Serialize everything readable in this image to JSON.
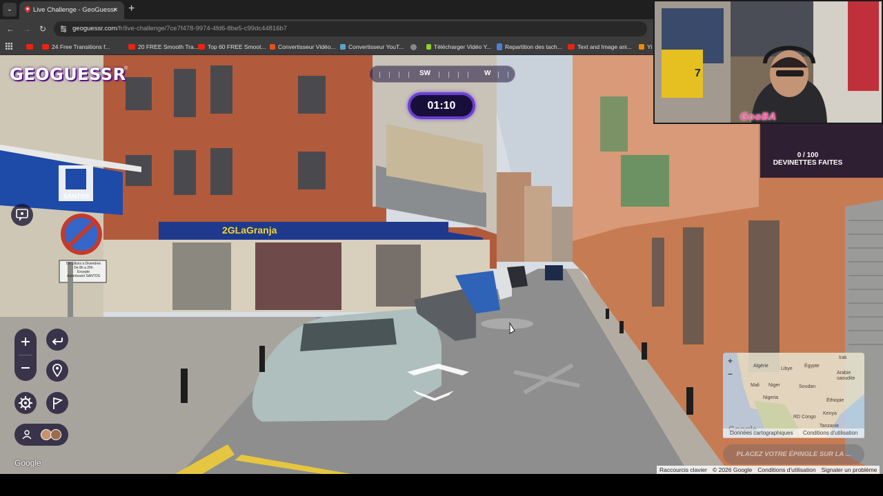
{
  "browser": {
    "tab_title": "Live Challenge - GeoGuessr",
    "url_host": "geoguessr.com",
    "url_path": "/fr/live-challenge/7ce7f478-9974-4fd6-8be5-c99dc44816b7",
    "bookmarks": [
      {
        "label": "24 Free Transitions f..."
      },
      {
        "label": "20 FREE Smooth Tra..."
      },
      {
        "label": "Top 60 FREE Smoot..."
      },
      {
        "label": "Convertisseur Vidéo..."
      },
      {
        "label": "Convertisseur YouT..."
      },
      {
        "label": "Télécharger Vidéo Y..."
      },
      {
        "label": "Repartition des tach..."
      },
      {
        "label": "Text and Image ani..."
      },
      {
        "label": "Yi"
      }
    ]
  },
  "game": {
    "logo": "GEOGUESSR",
    "logo_reg": "®",
    "compass": {
      "left": "SW",
      "right": "W"
    },
    "timer": "01:10",
    "guesses_count": "0 / 100",
    "guesses_label": "DEVINETTES FAITES",
    "place_pin": "PLACEZ VOTRE ÉPINGLE SUR LA ..."
  },
  "storefront": {
    "sign_text": "2GLaGranja",
    "santos": "SANTOS",
    "notice": "De Lilluns a Divendres\nDe 8h a 20h\nExcepte\nAutorització SANTOS"
  },
  "streamer": {
    "overlay_name": "GooBA",
    "shirt_number": "7"
  },
  "minimap": {
    "labels": [
      "Algérie",
      "Libye",
      "Égypte",
      "Irak",
      "Arabie saoudite",
      "Mali",
      "Niger",
      "Soudan",
      "Nigeria",
      "Éthiopie",
      "RD Congo",
      "Kenya",
      "Tanzanie"
    ],
    "data_label": "Données cartographiques",
    "terms_label": "Conditions d'utilisation",
    "google": "Google"
  },
  "footer": {
    "google": "Google",
    "links": [
      "Raccourcis clavier",
      "© 2026 Google",
      "Conditions d'utilisation",
      "Signaler un problème"
    ]
  },
  "colors": {
    "timer_border": "#6a3fd4",
    "panel": "#170f3a",
    "brand_red": "#e21"
  }
}
